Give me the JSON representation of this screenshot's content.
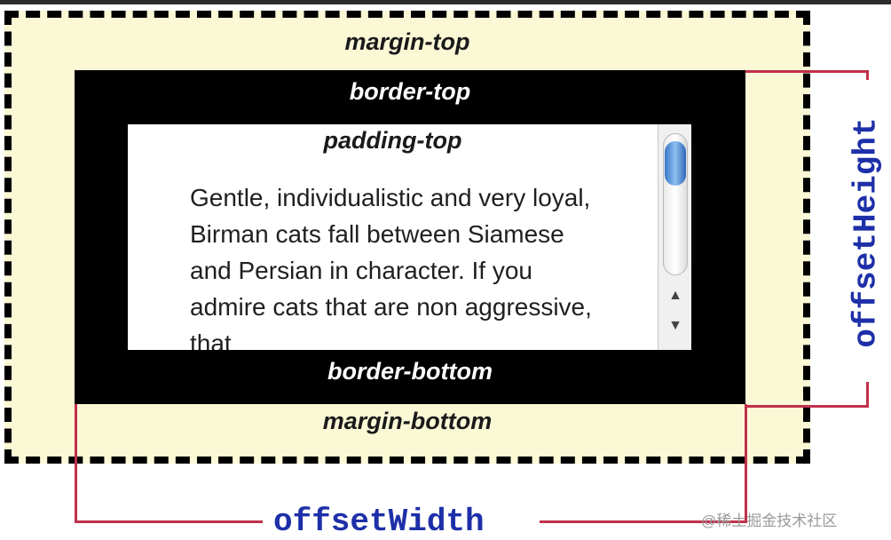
{
  "labels": {
    "margin_top": "margin-top",
    "border_top": "border-top",
    "padding_top": "padding-top",
    "border_bottom": "border-bottom",
    "margin_bottom": "margin-bottom"
  },
  "content": {
    "body_text": "Gentle, individualistic and very loyal, Birman cats fall between Siamese and Persian in character. If you admire cats that are non aggressive, that"
  },
  "metrics": {
    "offset_height": "offsetHeight",
    "offset_width": "offsetWidth"
  },
  "watermark": "@稀土掘金技术社区",
  "colors": {
    "margin_fill": "#fbf8d6",
    "border_fill": "#000000",
    "bracket_line": "#c0304a",
    "metric_text": "#1d2fa8"
  }
}
